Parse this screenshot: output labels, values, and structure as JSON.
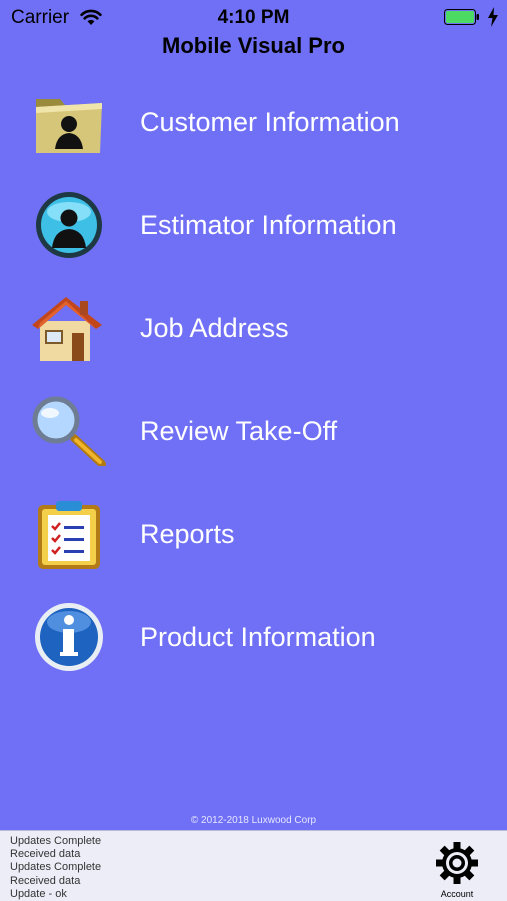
{
  "status_bar": {
    "carrier": "Carrier",
    "time": "4:10 PM",
    "battery_color": "#4cd964",
    "icons": [
      "wifi-icon",
      "battery-icon",
      "charging-bolt-icon"
    ]
  },
  "app": {
    "title": "Mobile Visual Pro"
  },
  "menu": {
    "items": [
      {
        "label": "Customer Information",
        "icon": "folder-person-icon"
      },
      {
        "label": "Estimator Information",
        "icon": "user-circle-icon"
      },
      {
        "label": "Job Address",
        "icon": "house-icon"
      },
      {
        "label": "Review Take-Off",
        "icon": "magnifier-icon"
      },
      {
        "label": "Reports",
        "icon": "clipboard-checklist-icon"
      },
      {
        "label": "Product Information",
        "icon": "info-icon"
      }
    ]
  },
  "footer": {
    "copyright": "© 2012-2018 Luxwood Corp",
    "log_lines": [
      "Updates Complete",
      "Received data",
      "Updates Complete",
      "Received data",
      "Update - ok"
    ],
    "account_label": "Account",
    "account_icon": "gear-icon"
  },
  "colors": {
    "background": "#7070f7",
    "menu_text": "#ffffff",
    "panel": "#ededf7"
  }
}
